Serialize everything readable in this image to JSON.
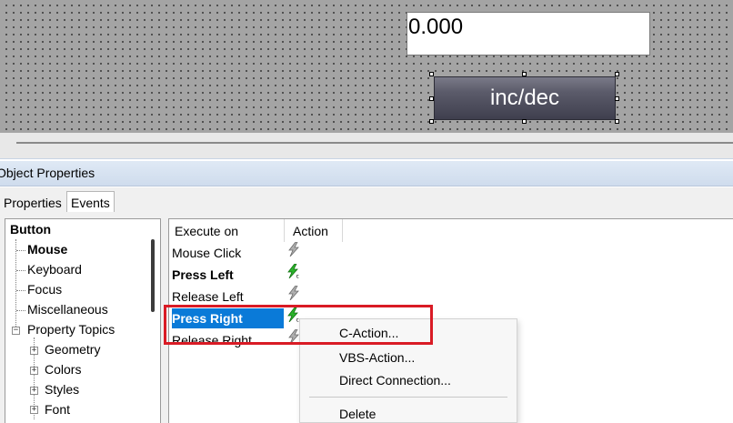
{
  "canvas": {
    "value_field_text": "0.000",
    "button_label": "inc/dec"
  },
  "panel": {
    "title": "Object Properties",
    "tabs": [
      "Properties",
      "Events"
    ],
    "active_tab": "Events"
  },
  "tree": {
    "items": [
      {
        "label": "Button"
      },
      {
        "label": "Mouse"
      },
      {
        "label": "Keyboard"
      },
      {
        "label": "Focus"
      },
      {
        "label": "Miscellaneous"
      },
      {
        "label": "Property Topics"
      },
      {
        "label": "Geometry"
      },
      {
        "label": "Colors"
      },
      {
        "label": "Styles"
      },
      {
        "label": "Font"
      }
    ]
  },
  "events": {
    "columns": [
      "Execute on",
      "Action"
    ],
    "rows": [
      {
        "label": "Mouse Click",
        "action_icon": "lightning-gray-icon"
      },
      {
        "label": "Press Left",
        "action_icon": "lightning-green-c-icon"
      },
      {
        "label": "Release Left",
        "action_icon": "lightning-gray-icon"
      },
      {
        "label": "Press Right",
        "action_icon": "lightning-green-c-icon"
      },
      {
        "label": "Release Right",
        "action_icon": "lightning-gray-icon"
      }
    ],
    "selected_row": "Press Right"
  },
  "context_menu": {
    "items": [
      "C-Action...",
      "VBS-Action...",
      "Direct Connection...",
      "Delete"
    ]
  },
  "colors": {
    "selection": "#0a7ad8",
    "highlight_box": "#d91b25",
    "bolt_green": "#2bb52b",
    "bolt_gray": "#8c8c8c"
  }
}
